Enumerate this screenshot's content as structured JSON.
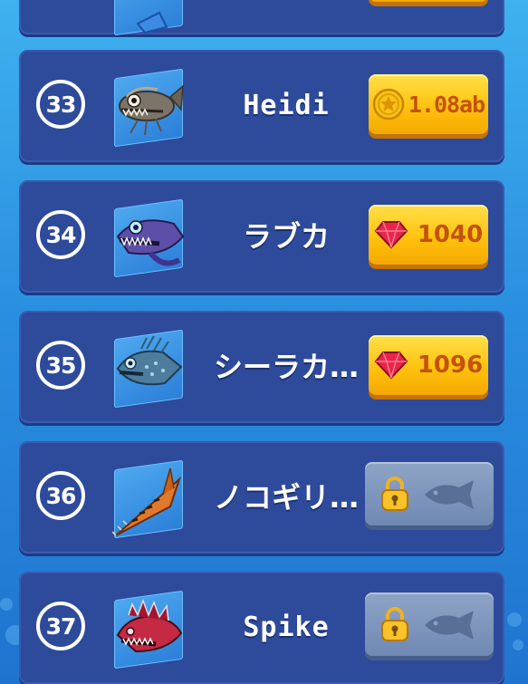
{
  "rows": [
    {
      "rank": "",
      "name": "",
      "price": "",
      "currency": "coin",
      "state": "partial",
      "creature_icon": "partial-shark-icon"
    },
    {
      "rank": "33",
      "name": "Heidi",
      "price": "1.08ab",
      "currency": "coin",
      "state": "buyable",
      "creature_icon": "anglerfish-icon"
    },
    {
      "rank": "34",
      "name": "ラブカ",
      "price": "1040",
      "currency": "gem",
      "state": "buyable",
      "creature_icon": "frilled-shark-icon"
    },
    {
      "rank": "35",
      "name": "シーラカ…",
      "price": "1096",
      "currency": "gem",
      "state": "buyable",
      "creature_icon": "coelacanth-icon"
    },
    {
      "rank": "36",
      "name": "ノコギリ…",
      "price": "",
      "currency": "",
      "state": "locked",
      "creature_icon": "sawfish-icon"
    },
    {
      "rank": "37",
      "name": "Spike",
      "price": "",
      "currency": "",
      "state": "locked",
      "creature_icon": "spiky-fish-icon"
    }
  ],
  "colors": {
    "row_bg": "#2e4a9a",
    "price_button": "#ffc20e",
    "price_text": "#c4520a",
    "locked_button": "#7f97bd",
    "background": "#2a8fe0"
  }
}
